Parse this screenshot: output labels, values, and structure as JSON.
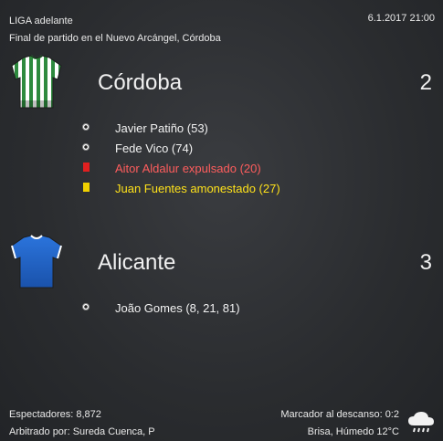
{
  "header": {
    "competition": "LIGA adelante",
    "description": "Final de partido en el Nuevo Arcángel, Córdoba",
    "datetime": "6.1.2017 21:00"
  },
  "home": {
    "name": "Córdoba",
    "score": "2",
    "kit_icon": "striped-shirt-icon",
    "kit_colors": {
      "primary": "#2e8a3e",
      "secondary": "#ffffff"
    },
    "events": [
      {
        "type": "goal",
        "icon": "ball-icon",
        "text": "Javier Patiño (53)"
      },
      {
        "type": "goal",
        "icon": "ball-icon",
        "text": "Fede Vico (74)"
      },
      {
        "type": "red-card",
        "icon": "red-card-icon",
        "text": "Aitor Aldalur expulsado (20)"
      },
      {
        "type": "yellow-card",
        "icon": "yellow-card-icon",
        "text": "Juan Fuentes amonestado (27)"
      }
    ]
  },
  "away": {
    "name": "Alicante",
    "score": "3",
    "kit_icon": "blue-shirt-icon",
    "kit_colors": {
      "primary": "#1f63c9",
      "secondary": "#ffffff"
    },
    "events": [
      {
        "type": "goal",
        "icon": "ball-icon",
        "text": "João Gomes (8, 21, 81)"
      }
    ]
  },
  "footer": {
    "attendance": "Espectadores: 8,872",
    "referee": "Arbitrado por: Sureda Cuenca, P",
    "halftime": "Marcador al descanso: 0:2",
    "weather": "Brisa, Húmedo 12°C",
    "weather_icon": "cloud-rain-icon"
  },
  "colors": {
    "red_card": "#e02020",
    "yellow_card": "#f0d000",
    "red_text": "#ff5d5d",
    "yellow_text": "#ffe21a"
  }
}
